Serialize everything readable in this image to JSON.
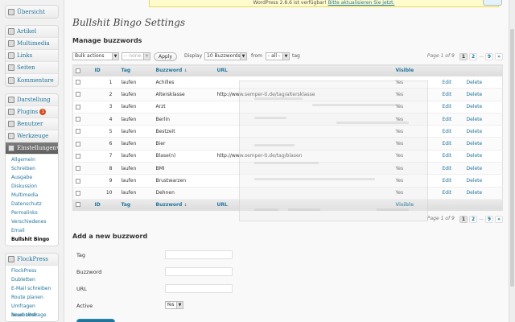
{
  "notice": {
    "text": "WordPress 2.8.6 ist verfügbar!",
    "link": "Bitte aktualisieren Sie jetzt."
  },
  "sidebar": {
    "dashboard": "Übersicht",
    "posts": "Artikel",
    "media": "Multimedia",
    "links": "Links",
    "pages": "Seiten",
    "comments": "Kommentare",
    "appearance": "Darstellung",
    "plugins": "Plugins",
    "plugins_badge": "1",
    "users": "Benutzer",
    "tools": "Werkzeuge",
    "settings": "Einstellungen",
    "settings_sub": [
      "Allgemein",
      "Schreiben",
      "Ausgabe",
      "Diskussion",
      "Multimedia",
      "Datenschutz",
      "Permalinks",
      "Verschiedenes",
      "Email",
      "Bullshit Bingo"
    ],
    "flockpress": "FlockPress",
    "flockpress_sub": [
      "FlockPress",
      "Dubletten",
      "E-Mail schreiben",
      "Route planen",
      "Umfragen bearbeiten",
      "Neue Umfrage"
    ]
  },
  "page": {
    "title": "Bullshit Bingo Settings",
    "section": "Manage buzzwords"
  },
  "tablenav": {
    "bulk_actions": "Bulk actions",
    "none": "-- none --",
    "apply": "Apply",
    "display_label": "Display",
    "per_page": "10 Buzzwords",
    "from_label": "from",
    "tag_filter": "- all -",
    "tag_label": "tag",
    "page_info": "Page 1 of 9",
    "pages": [
      "1",
      "2"
    ],
    "dots": "...",
    "last": "9",
    "next": "»"
  },
  "table": {
    "columns": {
      "id": "ID",
      "tag": "Tag",
      "buzzword": "Buzzword",
      "url": "URL",
      "visible": "Visible"
    },
    "rows": [
      {
        "id": "1",
        "tag": "laufen",
        "buzzword": "Achilles",
        "url": "",
        "visible": "Yes",
        "edit": "Edit",
        "delete": "Delete"
      },
      {
        "id": "2",
        "tag": "laufen",
        "buzzword": "Altersklasse",
        "url": "http://www.semper-ti.de/tag/altersklasse",
        "visible": "Yes",
        "edit": "Edit",
        "delete": "Delete"
      },
      {
        "id": "3",
        "tag": "laufen",
        "buzzword": "Arzt",
        "url": "",
        "visible": "Yes",
        "edit": "Edit",
        "delete": "Delete"
      },
      {
        "id": "4",
        "tag": "laufen",
        "buzzword": "Berlin",
        "url": "",
        "visible": "Yes",
        "edit": "Edit",
        "delete": "Delete"
      },
      {
        "id": "5",
        "tag": "laufen",
        "buzzword": "Bestzeit",
        "url": "",
        "visible": "Yes",
        "edit": "Edit",
        "delete": "Delete"
      },
      {
        "id": "6",
        "tag": "laufen",
        "buzzword": "Bier",
        "url": "",
        "visible": "Yes",
        "edit": "Edit",
        "delete": "Delete"
      },
      {
        "id": "7",
        "tag": "laufen",
        "buzzword": "Blase(n)",
        "url": "http://www.semper-ti.de/tag/blasen",
        "visible": "Yes",
        "edit": "Edit",
        "delete": "Delete"
      },
      {
        "id": "8",
        "tag": "laufen",
        "buzzword": "BMI",
        "url": "",
        "visible": "Yes",
        "edit": "Edit",
        "delete": "Delete"
      },
      {
        "id": "9",
        "tag": "laufen",
        "buzzword": "Brustwarzen",
        "url": "",
        "visible": "Yes",
        "edit": "Edit",
        "delete": "Delete"
      },
      {
        "id": "10",
        "tag": "laufen",
        "buzzword": "Dehnen",
        "url": "",
        "visible": "Yes",
        "edit": "Edit",
        "delete": "Delete"
      }
    ]
  },
  "add_form": {
    "title": "Add a new buzzword",
    "tag_label": "Tag",
    "buzzword_label": "Buzzword",
    "url_label": "URL",
    "active_label": "Active",
    "active_value": "Yes"
  },
  "colors": {
    "link": "#21759b",
    "notice_bg": "#fffbcc",
    "menu_current": "#6d6d6d"
  }
}
